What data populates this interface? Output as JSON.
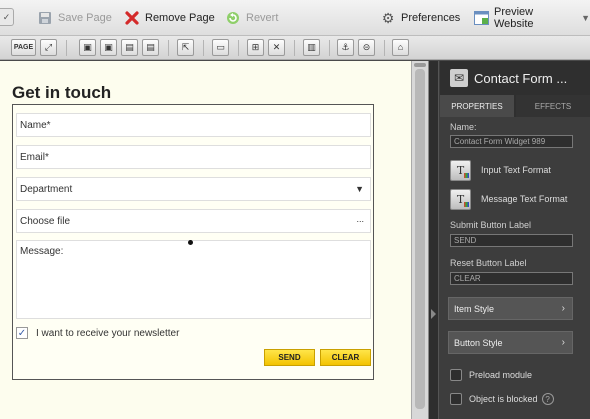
{
  "toolbar": {
    "save_page": "Save Page",
    "remove_page": "Remove Page",
    "revert": "Revert",
    "preferences": "Preferences",
    "preview_website": "Preview Website"
  },
  "toolstrip": {
    "page_label": "PAGE"
  },
  "canvas": {
    "title": "Get in touch",
    "fields": {
      "name": "Name*",
      "email": "Email*",
      "department": "Department",
      "choose_file": "Choose file",
      "choose_file_button": "...",
      "message": "Message:"
    },
    "newsletter_label": "I want to receive your newsletter",
    "send_label": "SEND",
    "clear_label": "CLEAR"
  },
  "panel": {
    "title": "Contact Form ...",
    "tabs": {
      "properties": "PROPERTIES",
      "effects": "EFFECTS"
    },
    "name_label": "Name:",
    "name_value": "Contact Form Widget 989",
    "input_text_format": "Input Text Format",
    "message_text_format": "Message Text Format",
    "submit_label_title": "Submit Button Label",
    "submit_label_value": "SEND",
    "reset_label_title": "Reset Button Label",
    "reset_label_value": "CLEAR",
    "item_style": "Item Style",
    "button_style": "Button Style",
    "preload_module": "Preload module",
    "object_blocked": "Object is blocked"
  },
  "colors": {
    "accent_yellow": "#f3c300",
    "panel_bg": "#3d3d3d",
    "canvas_bg": "#fdfdee"
  }
}
